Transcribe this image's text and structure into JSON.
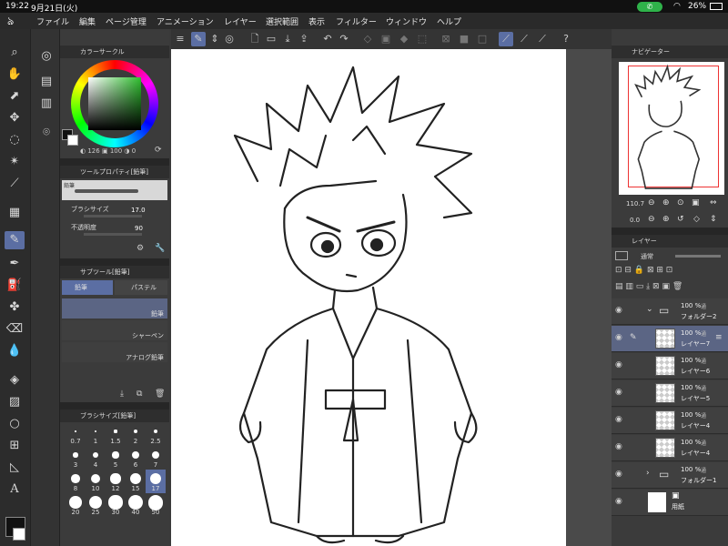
{
  "status_bar": {
    "time": "19:22",
    "date": "9月21日(火)",
    "battery": "26%"
  },
  "menu": [
    "ファイル",
    "編集",
    "ページ管理",
    "アニメーション",
    "レイヤー",
    "選択範囲",
    "表示",
    "フィルター",
    "ウィンドウ",
    "ヘルプ"
  ],
  "color_circle": {
    "title": "カラーサークル",
    "h": "126",
    "s": "100",
    "v": "0",
    "fg": "#111111",
    "bg": "#ffffff"
  },
  "tool_property": {
    "title": "ツールプロパティ[鉛筆]",
    "brush_name": "鉛筆",
    "brush_size_label": "ブラシサイズ",
    "brush_size_value": "17.0",
    "opacity_label": "不透明度",
    "opacity_value": "90"
  },
  "sub_tool": {
    "title": "サブツール[鉛筆]",
    "tabs": [
      "鉛筆",
      "パステル"
    ],
    "items": [
      "鉛筆",
      "シャーペン",
      "アナログ鉛筆"
    ]
  },
  "brush_size": {
    "title": "ブラシサイズ[鉛筆]",
    "values": [
      "0.7",
      "1",
      "1.5",
      "2",
      "2.5",
      "3",
      "4",
      "5",
      "6",
      "7",
      "8",
      "10",
      "12",
      "15",
      "17",
      "20",
      "25",
      "30",
      "40",
      "50"
    ],
    "selected": "17"
  },
  "navigator": {
    "title": "ナビゲーター",
    "zoom": "110.7",
    "rotation": "0.0"
  },
  "layer_panel": {
    "title": "レイヤー",
    "blend": "通常",
    "layers": [
      {
        "pct": "100 %",
        "blend": "通",
        "name": "フォルダー2",
        "type": "folder"
      },
      {
        "pct": "100 %",
        "blend": "通",
        "name": "レイヤー7",
        "type": "layer",
        "selected": true
      },
      {
        "pct": "100 %",
        "blend": "通",
        "name": "レイヤー6",
        "type": "layer"
      },
      {
        "pct": "100 %",
        "blend": "通",
        "name": "レイヤー5",
        "type": "layer"
      },
      {
        "pct": "100 %",
        "blend": "通",
        "name": "レイヤー4",
        "type": "layer"
      },
      {
        "pct": "100 %",
        "blend": "通",
        "name": "レイヤー4",
        "type": "layer"
      },
      {
        "pct": "100 %",
        "blend": "通",
        "name": "フォルダー1",
        "type": "folder"
      },
      {
        "pct": "",
        "blend": "",
        "name": "用紙",
        "type": "paper"
      }
    ]
  },
  "colors": {
    "accent": "#5b6ea3",
    "selected_layer": "#5b6584"
  }
}
